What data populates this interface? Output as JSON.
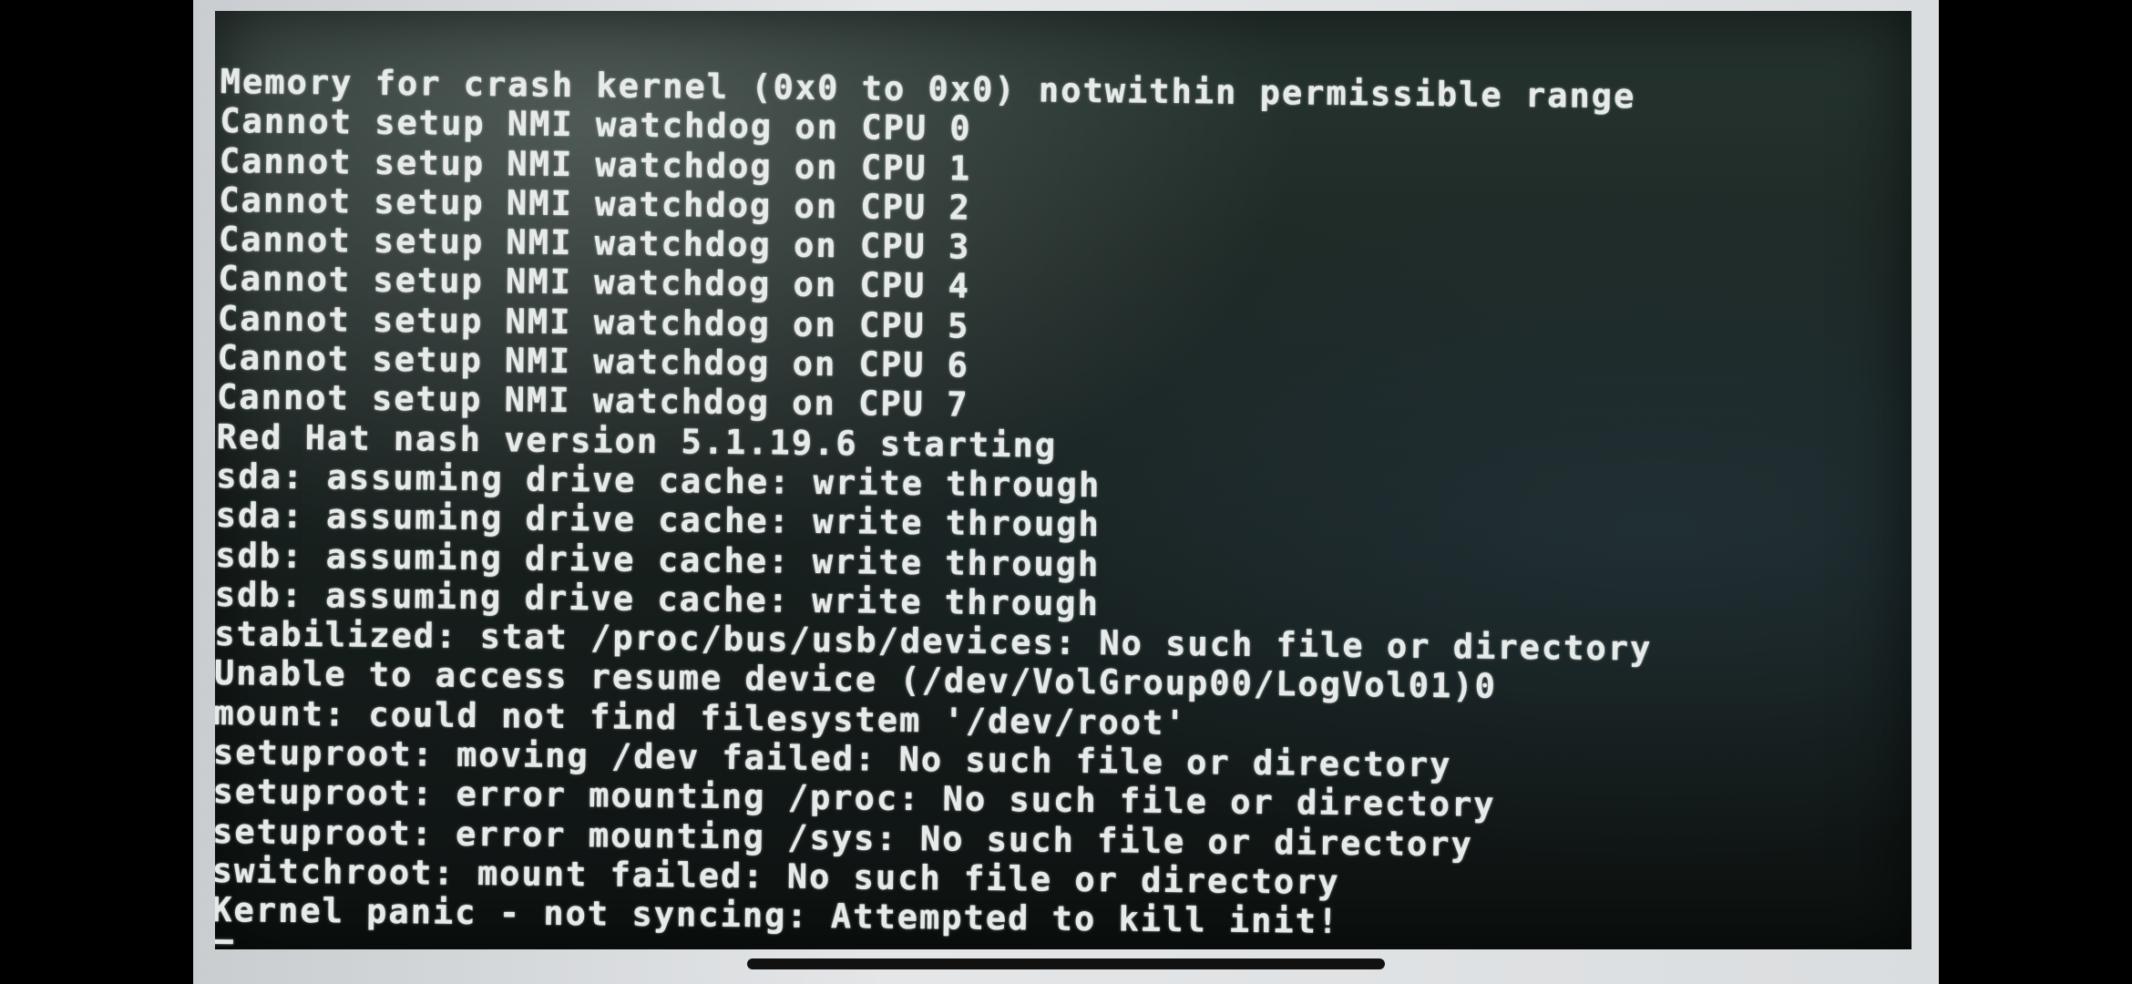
{
  "console": {
    "lines": [
      "Memory for crash kernel (0x0 to 0x0) notwithin permissible range",
      "Cannot setup NMI watchdog on CPU 0",
      "Cannot setup NMI watchdog on CPU 1",
      "Cannot setup NMI watchdog on CPU 2",
      "Cannot setup NMI watchdog on CPU 3",
      "Cannot setup NMI watchdog on CPU 4",
      "Cannot setup NMI watchdog on CPU 5",
      "Cannot setup NMI watchdog on CPU 6",
      "Cannot setup NMI watchdog on CPU 7",
      "Red Hat nash version 5.1.19.6 starting",
      "sda: assuming drive cache: write through",
      "sda: assuming drive cache: write through",
      "sdb: assuming drive cache: write through",
      "sdb: assuming drive cache: write through",
      "stabilized: stat /proc/bus/usb/devices: No such file or directory",
      "Unable to access resume device (/dev/VolGroup00/LogVol01)0",
      "mount: could not find filesystem '/dev/root'",
      "setuproot: moving /dev failed: No such file or directory",
      "setuproot: error mounting /proc: No such file or directory",
      "setuproot: error mounting /sys: No such file or directory",
      "switchroot: mount failed: No such file or directory",
      "Kernel panic - not syncing: Attempted to kill init!"
    ]
  },
  "colors": {
    "text": "#e6ebea",
    "screen": "#1a2321",
    "bezel": "#dadddf"
  }
}
